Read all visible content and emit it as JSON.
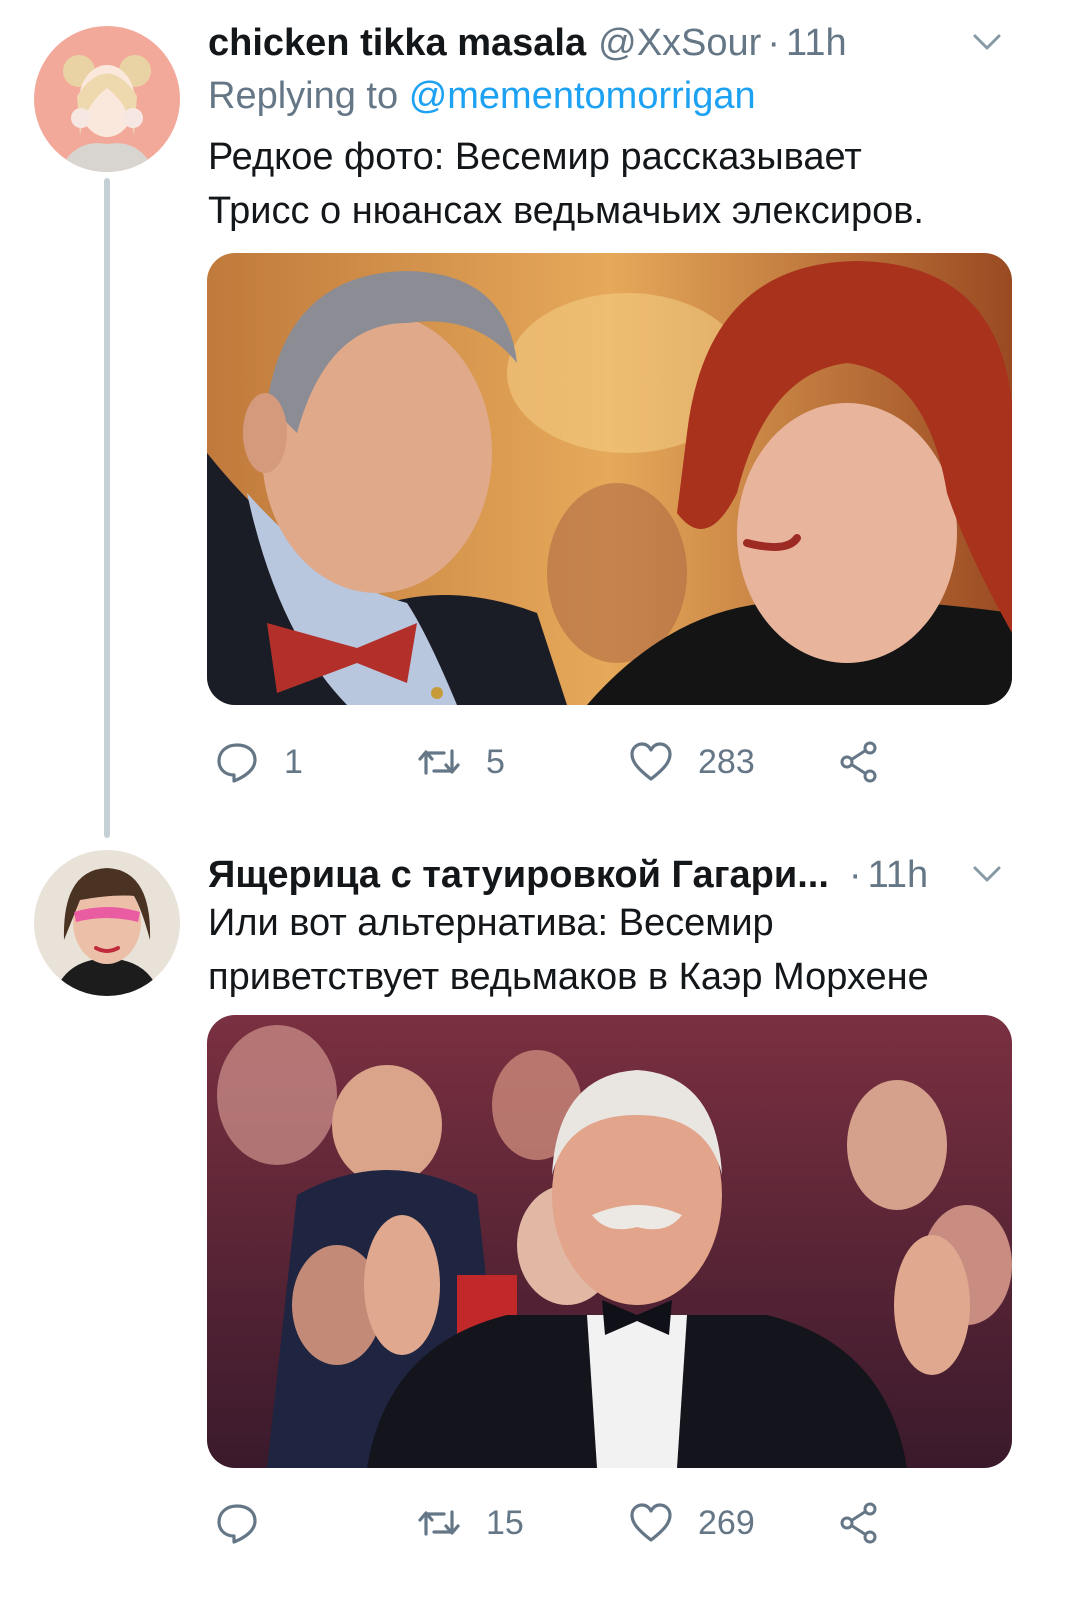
{
  "tweets": [
    {
      "name": "chicken tikka masala",
      "handle": "@XxSour",
      "separator": "·",
      "time": "11h",
      "replying_prefix": "Replying to",
      "replying_to": "@mementomorrigan",
      "text_lines": [
        "Редкое фото: Весемир рассказывает",
        "Трисс о нюансах ведьмачьих элексиров."
      ],
      "stats": {
        "replies": "1",
        "retweets": "5",
        "likes": "283"
      }
    },
    {
      "name": "Ящерица с татуировкой Гагари...",
      "separator": "·",
      "time": "11h",
      "text_lines": [
        "Или вот альтернатива: Весемир",
        "приветствует ведьмаков в Каэр Морхене"
      ],
      "stats": {
        "replies": "",
        "retweets": "15",
        "likes": "269"
      }
    }
  ],
  "icons": {
    "caret": "chevron-down-icon",
    "reply": "reply-icon",
    "retweet": "retweet-icon",
    "like": "heart-icon",
    "share": "share-icon"
  },
  "colors": {
    "text_primary": "#14171a",
    "text_secondary": "#657786",
    "link": "#1da1f2",
    "thread_line": "#c4cfd6"
  }
}
